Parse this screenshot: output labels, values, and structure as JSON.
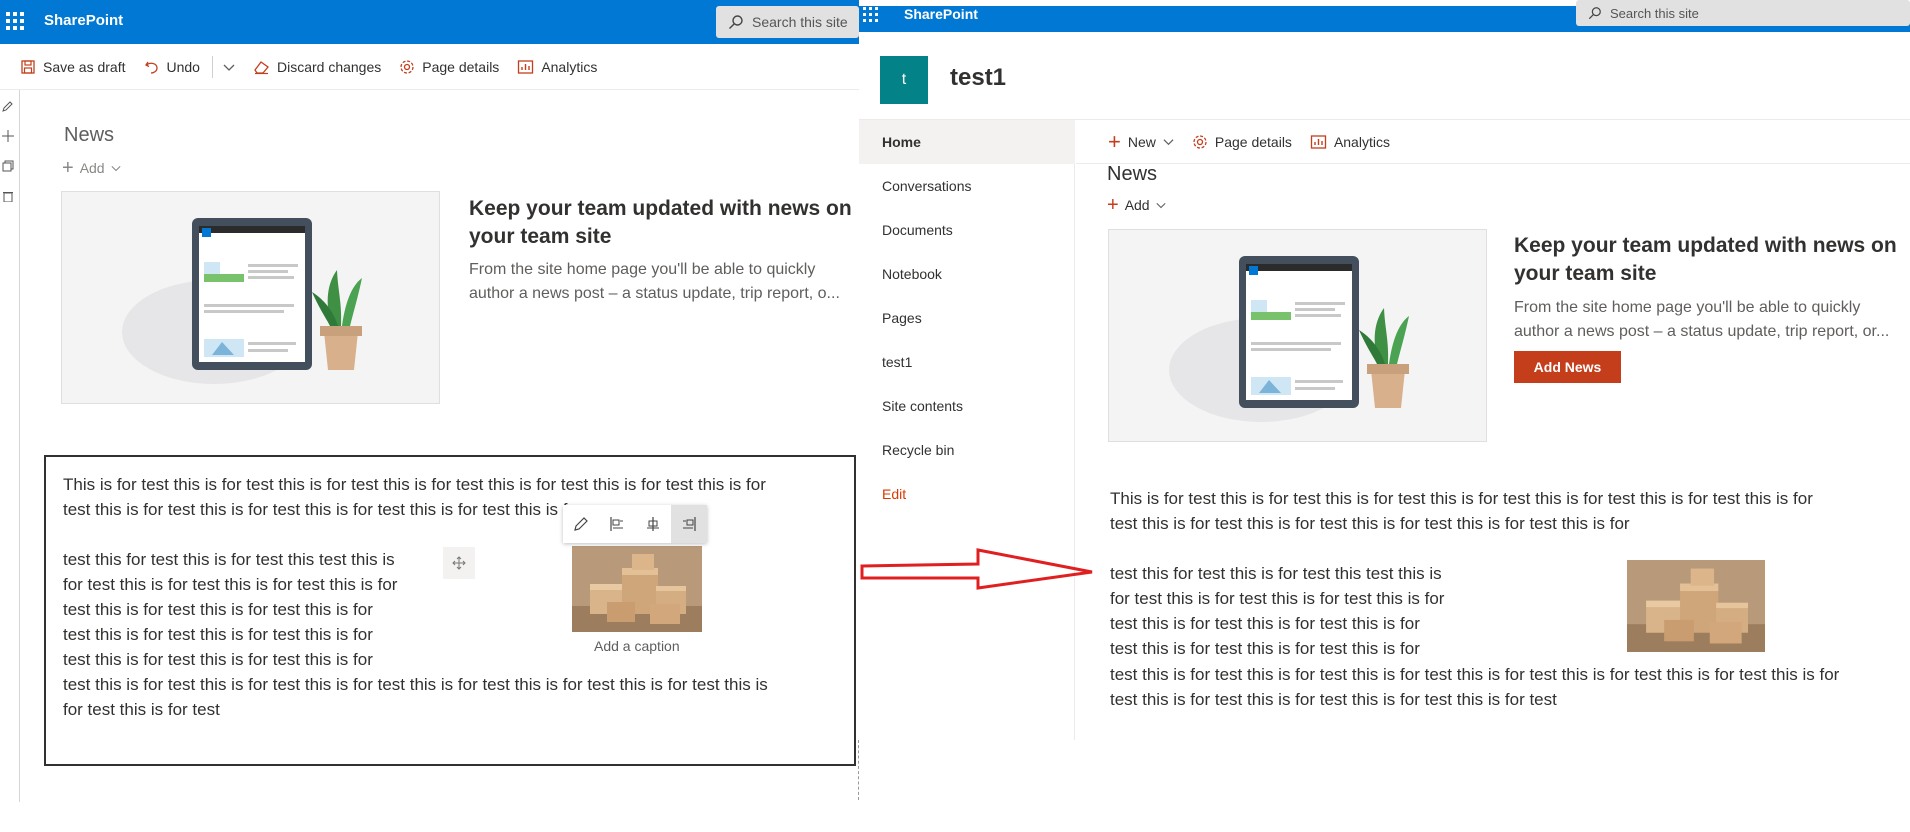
{
  "colors": {
    "suite_bar": "#0078d4",
    "accent_orange": "#c43e1c",
    "site_logo_bg": "#038387",
    "arrow": "#e02020"
  },
  "left": {
    "brand": "SharePoint",
    "search_placeholder": "Search this site",
    "commands": {
      "save_draft": "Save as draft",
      "undo": "Undo",
      "discard": "Discard changes",
      "page_details": "Page details",
      "analytics": "Analytics"
    },
    "news": {
      "title": "News",
      "add": "Add",
      "heading_line1": "Keep your team updated with news on",
      "heading_line2": "your team site",
      "desc_line1": "From the site home page you'll be able to quickly",
      "desc_line2": "author a news post – a status update, trip report, o..."
    },
    "text_webpart": {
      "p1_line1": "This is for test this is for test this is for test this is for test this is for test this is for test this is for",
      "p1_line2": "test this is for test this is for test this is for test this is for test this is for",
      "p2_line1": "test this  for test this is for test this test this is",
      "p2_line2": "for test this is for test this is for test this is for",
      "p2_line3": "test this is for test this is for test this is for",
      "p2_line4": "test this is for test this is for test this is for",
      "p2_line5": "test this is for test this is for test this is for",
      "p3_line1": "test this is for test this is for test this is for test this is for test this is for test this is for test this is",
      "p3_line2": "for test this is for test",
      "image_caption": "Add a caption"
    }
  },
  "right": {
    "brand": "SharePoint",
    "search_placeholder": "Search this site",
    "site": {
      "logo_letter": "t",
      "title": "test1"
    },
    "nav": [
      "Home",
      "Conversations",
      "Documents",
      "Notebook",
      "Pages",
      "test1",
      "Site contents",
      "Recycle bin",
      "Edit"
    ],
    "commands": {
      "new": "New",
      "page_details": "Page details",
      "analytics": "Analytics"
    },
    "news": {
      "title": "News",
      "add": "Add",
      "heading_line1": "Keep your team updated with news on",
      "heading_line2": "your team site",
      "desc_line1": "From the site home page you'll be able to quickly",
      "desc_line2": "author a news post – a status update, trip report, or...",
      "add_news_button": "Add News"
    },
    "text_webpart": {
      "p1_line1": "This is for test this is for test this is for test this is for test this is for test this is for test this is for",
      "p1_line2": "test this is for test this is for test this is for test this is for test this is for",
      "p2_line1": "test this  for test this is for test this test this is",
      "p2_line2": "for test this is for test this is for test this is for",
      "p2_line3": "test this is for test this is for test this is for",
      "p2_line4": "test this is for test this is for test this is for",
      "p3_line1": "test this is for test this is for test this is for test this is for test this is for test this is for test this is for",
      "p3_line2": "test this is for test this is for test this is for test this is for test"
    }
  }
}
